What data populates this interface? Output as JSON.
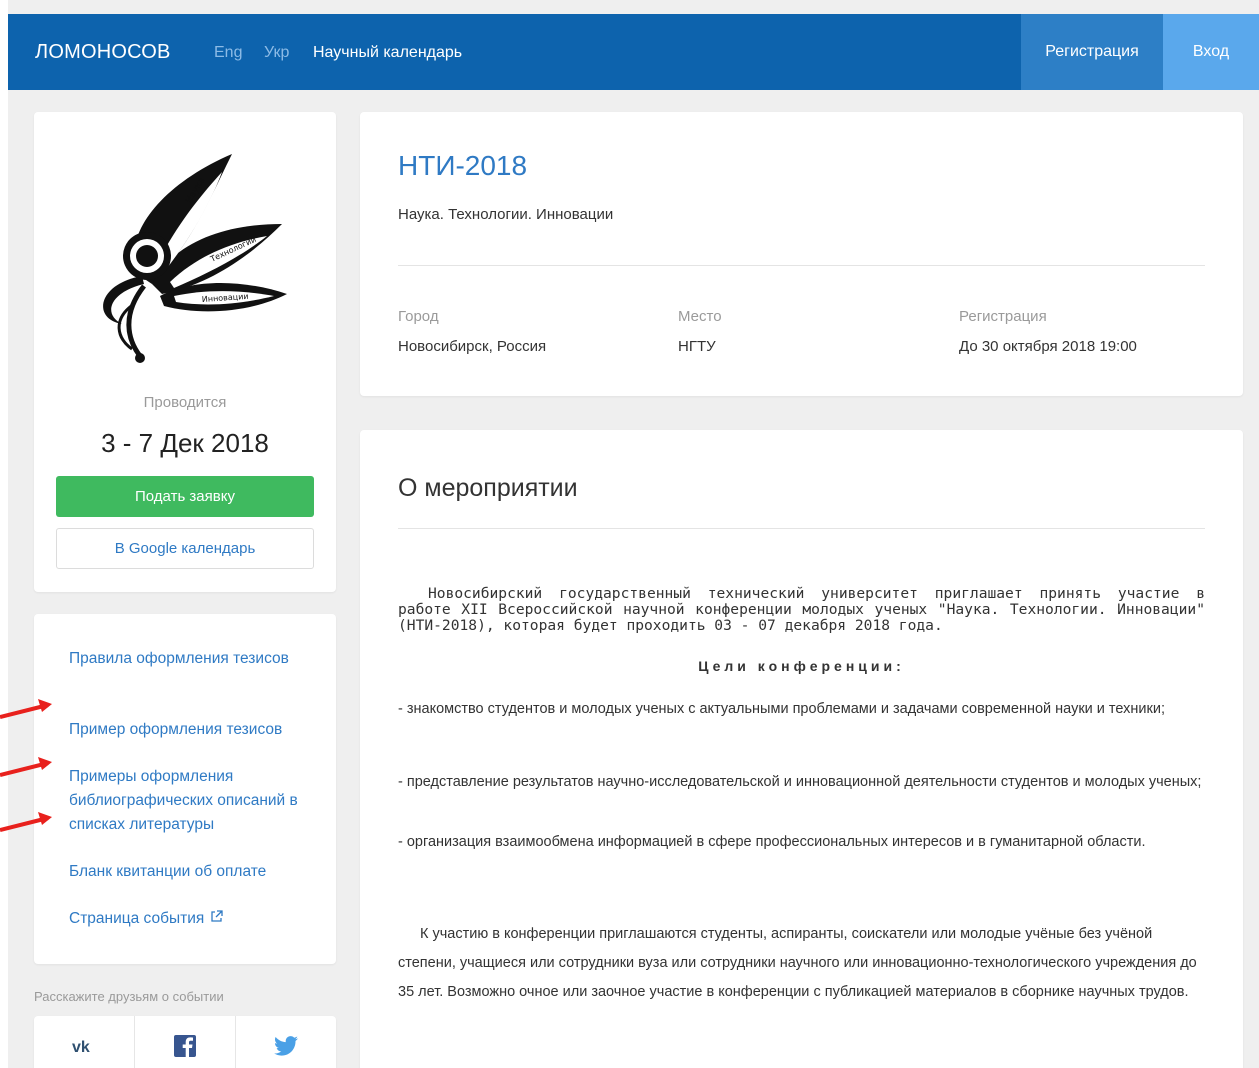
{
  "nav": {
    "brand": "ЛОМОНОСОВ",
    "lang_eng": "Eng",
    "lang_ukr": "Укр",
    "calendar": "Научный календарь",
    "register": "Регистрация",
    "login": "Вход"
  },
  "event_card": {
    "logo_texts": [
      "Наука",
      "Технологии",
      "Инновации"
    ],
    "held_label": "Проводится",
    "dates": "3 - 7 Дек 2018",
    "apply_button": "Подать заявку",
    "google_calendar_button": "В Google календарь"
  },
  "sidebar_links": [
    {
      "label": "Правила оформления тезисов"
    },
    {
      "label": "Пример оформления тезисов"
    },
    {
      "label": "Примеры оформления библиографических описаний в списках литературы"
    },
    {
      "label": "Бланк квитанции об оплате"
    },
    {
      "label": "Страница события"
    }
  ],
  "share": {
    "label": "Расскажите друзьям о событии",
    "networks": [
      "vk-icon",
      "facebook-icon",
      "twitter-icon"
    ]
  },
  "header": {
    "title": "НТИ-2018",
    "subtitle": "Наука. Технологии. Инновации",
    "city_label": "Город",
    "city_value": "Новосибирск, Россия",
    "place_label": "Место",
    "place_value": "НГТУ",
    "registration_label": "Регистрация",
    "registration_value": "До 30 октября 2018 19:00"
  },
  "about": {
    "title": "О мероприятии",
    "intro": "Новосибирский государственный технический университет приглашает принять участие в работе XII Всероссийской научной конференции молодых ученых \"Наука. Технологии. Инновации\" (НТИ-2018), которая будет проходить 03 - 07 декабря 2018 года.",
    "goals_heading": "Цели конференции:",
    "goals": [
      "- знакомство студентов и молодых ученых с актуальными проблемами и задачами современной науки и техники;",
      "- представление результатов научно-исследовательской и инновационной деятельности студентов и молодых ученых;",
      "- организация взаимообмена информацией в сфере профессиональных интересов и в гуманитарной области."
    ],
    "participants": "К участию в конференции приглашаются студенты, аспиранты, соискатели или молодые учёные без учёной степени, учащиеся или сотрудники вуза или сотрудники научного или инновационно-технологического учреждения до 35 лет. Возможно очное или заочное участие в конференции с публикацией материалов в сборнике научных трудов."
  },
  "colors": {
    "navbar": "#0d63ad",
    "accent_link": "#2f7ac4",
    "apply_green": "#3fba5f",
    "annotation_arrow": "#e8211d"
  }
}
